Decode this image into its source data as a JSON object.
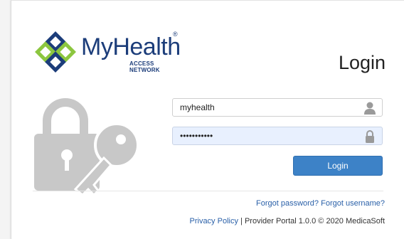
{
  "brand": {
    "name": "MyHealth",
    "registered_mark": "®",
    "subtitle": "ACCESS NETWORK",
    "colors": {
      "primary": "#1c3d7a",
      "accent": "#8cc63f"
    }
  },
  "title": "Login",
  "form": {
    "username_value": "myhealth",
    "password_value": "•••••••••••",
    "username_icon": "user-icon",
    "password_icon": "lock-icon",
    "login_label": "Login"
  },
  "links": {
    "forgot_password": "Forgot password?",
    "forgot_username": "Forgot username?",
    "privacy_policy": "Privacy Policy"
  },
  "footer": {
    "separator": "|",
    "portal_info": "Provider Portal 1.0.0 © 2020 MedicaSoft"
  },
  "theme": {
    "button": "#3d82c7",
    "link": "#2a60a8"
  }
}
